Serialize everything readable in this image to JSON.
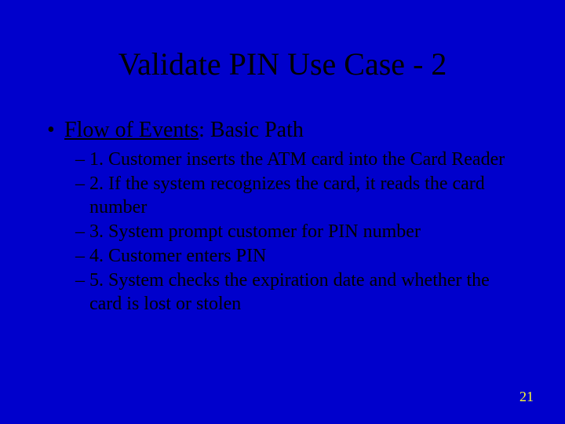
{
  "title": "Validate PIN Use Case - 2",
  "bullet_char": "•",
  "heading": {
    "underlined": "Flow of Events",
    "rest": ": Basic Path"
  },
  "dash_char": "–",
  "items": [
    {
      "idx": "1. ",
      "text": "Customer inserts the ATM card into the Card Reader"
    },
    {
      "idx": "2. ",
      "text": "If the system recognizes the card, it reads the card number"
    },
    {
      "idx": "3. ",
      "text": "System prompt customer for PIN number"
    },
    {
      "idx": "4. ",
      "text": "Customer enters PIN"
    },
    {
      "idx": "5. ",
      "text": "System checks the expiration date and whether the card is lost or stolen"
    }
  ],
  "page_number": "21"
}
